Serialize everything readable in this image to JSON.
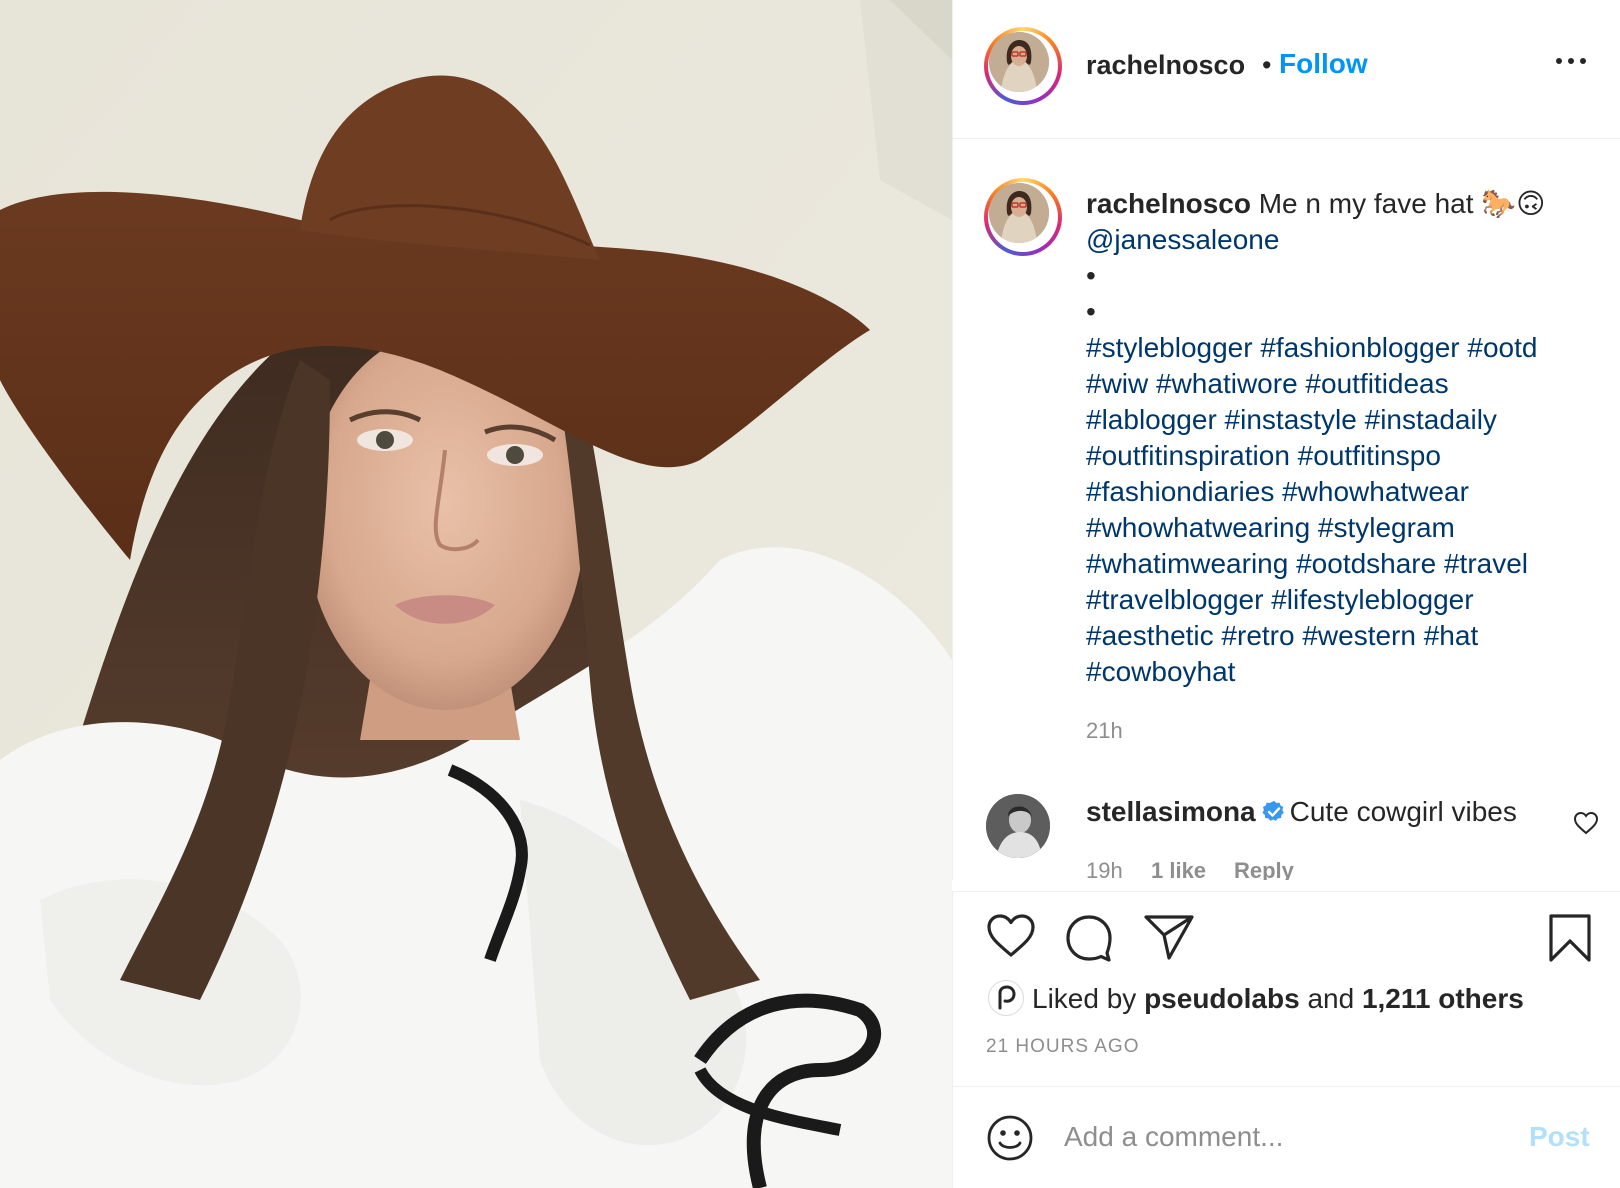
{
  "post": {
    "username": "rachelnosco",
    "separator": "•",
    "follow_label": "Follow",
    "more_icon": "more-horizontal-icon"
  },
  "caption": {
    "username": "rachelnosco",
    "text": "Me n my fave hat 🐎🙃",
    "mention": "@janessaleone",
    "bullet_lines": [
      "•",
      "•"
    ],
    "hashtag_lines": [
      "#styleblogger #fashionblogger #ootd",
      "#wiw #whatiwore #outfitideas",
      "#lablogger #instastyle #instadaily",
      "#outfitinspiration #outfitinspo",
      "#fashiondiaries #whowhatwear",
      "#whowhatwearing #stylegram",
      "#whatimwearing #ootdshare #travel",
      "#travelblogger #lifestyleblogger",
      "#aesthetic #retro #western #hat",
      "#cowboyhat"
    ],
    "time": "21h"
  },
  "comment": {
    "username": "stellasimona",
    "verified": true,
    "text": "Cute cowgirl vibes",
    "time": "19h",
    "likes": "1 like",
    "reply_label": "Reply"
  },
  "likes": {
    "prefix": "Liked by",
    "liker": "pseudolabs",
    "middle": "and",
    "others": "1,211 others"
  },
  "timestamp": "21 HOURS AGO",
  "add_comment": {
    "placeholder": "Add a comment...",
    "post_label": "Post"
  },
  "colors": {
    "link": "#00376b",
    "follow": "#0095f6",
    "post_disabled": "#b2dffc",
    "muted": "#8e8e8e"
  }
}
